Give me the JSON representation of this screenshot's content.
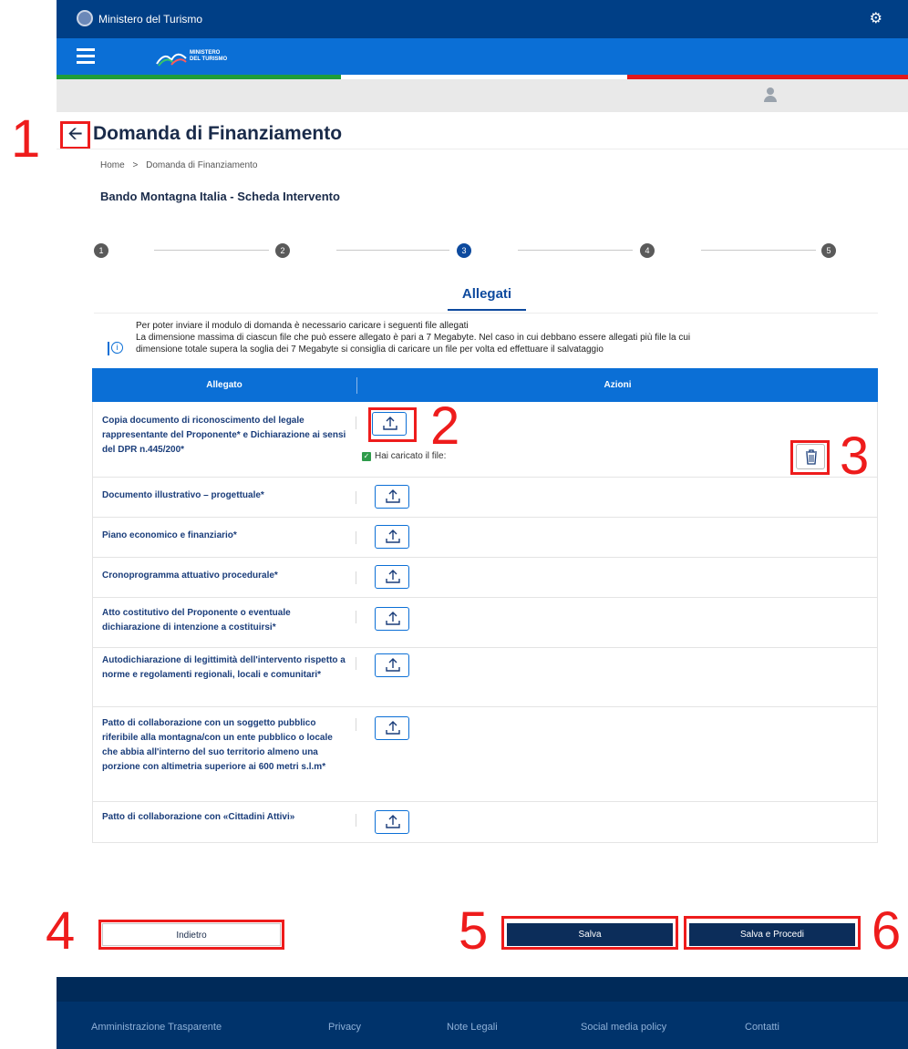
{
  "topbar": {
    "ministry_name": "Ministero del Turismo"
  },
  "navbar": {
    "logo_text_1": "MINISTERO",
    "logo_text_2": "DEL TURISMO"
  },
  "page": {
    "title": "Domanda di Finanziamento",
    "breadcrumb": {
      "home": "Home",
      "separator": ">",
      "current": "Domanda di Finanziamento"
    },
    "subtitle": "Bando Montagna Italia - Scheda Intervento"
  },
  "stepper": {
    "steps": [
      "1",
      "2",
      "3",
      "4",
      "5"
    ],
    "active_step": 3
  },
  "section": {
    "title": "Allegati"
  },
  "info": {
    "line1": "Per poter inviare il modulo di domanda è necessario caricare i seguenti file allegati",
    "line2": "La dimensione massima di ciascun file che può essere allegato è pari a 7 Megabyte. Nel caso in cui debbano essere allegati più file la cui",
    "line3": "dimensione totale supera la soglia dei 7 Megabyte si consiglia di caricare un file per volta ed effettuare il salvataggio"
  },
  "table": {
    "headers": {
      "allegato": "Allegato",
      "azioni": "Azioni"
    },
    "rows": [
      {
        "label": "Copia documento di riconoscimento del legale rappresentante del Proponente* e Dichiarazione ai sensi del DPR n.445/200*",
        "uploaded_text": "Hai caricato il file:"
      },
      {
        "label": "Documento illustrativo – progettuale*"
      },
      {
        "label": "Piano economico e finanziario*"
      },
      {
        "label": "Cronoprogramma attuativo procedurale*"
      },
      {
        "label": "Atto costitutivo del Proponente o eventuale dichiarazione di intenzione a costituirsi*"
      },
      {
        "label": "Autodichiarazione di legittimità dell'intervento rispetto a norme e regolamenti regionali, locali e comunitari*"
      },
      {
        "label": "Patto di collaborazione con un soggetto pubblico riferibile alla montagna/con un ente pubblico o locale che abbia all'interno del suo territorio almeno una porzione con altimetria superiore ai 600 metri s.l.m*"
      },
      {
        "label": "Patto di collaborazione con «Cittadini Attivi»"
      }
    ]
  },
  "actions": {
    "back": "Indietro",
    "save": "Salva",
    "save_next": "Salva e Procedi"
  },
  "footer": {
    "links": [
      "Amministrazione Trasparente",
      "Privacy",
      "Note Legali",
      "Social media policy",
      "Contatti"
    ]
  },
  "annotations": [
    "1",
    "2",
    "3",
    "4",
    "5",
    "6"
  ],
  "colors": {
    "header_dark": "#003f86",
    "nav_blue": "#0b6fd6",
    "button_dark": "#0c2d5a",
    "annotation_red": "#ee1c1c"
  }
}
